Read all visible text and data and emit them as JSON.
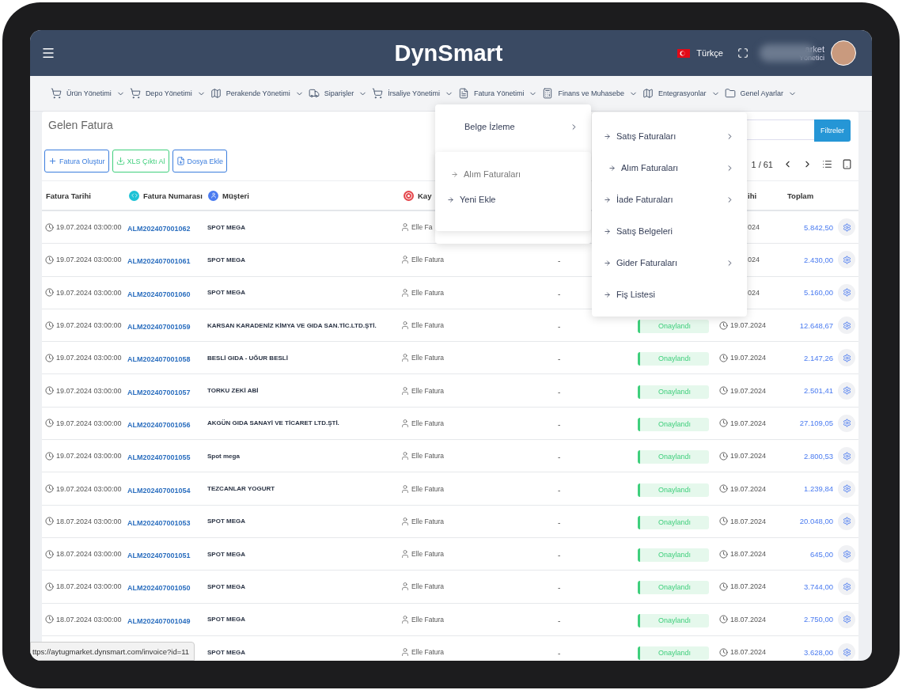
{
  "header": {
    "title": "DynSmart",
    "language": "Türkçe",
    "user_name": "arket",
    "user_role": "Yönetici"
  },
  "nav": [
    {
      "label": "Ürün Yönetimi"
    },
    {
      "label": "Depo Yönetimi"
    },
    {
      "label": "Perakende Yönetimi"
    },
    {
      "label": "Siparişler"
    },
    {
      "label": "İrsaliye Yönetimi"
    },
    {
      "label": "Fatura Yönetimi"
    },
    {
      "label": "Finans ve Muhasebe"
    },
    {
      "label": "Entegrasyonlar"
    },
    {
      "label": "Genel Ayarlar"
    }
  ],
  "page_title": "Gelen Fatura",
  "filter_button": "Filtreler",
  "actions": [
    {
      "label": "Fatura Oluştur",
      "kind": "create"
    },
    {
      "label": "XLS Çıktı Al",
      "kind": "export"
    },
    {
      "label": "Dosya Ekle",
      "kind": "upload"
    }
  ],
  "pagination": {
    "page": "1 / 61"
  },
  "columns": [
    {
      "label": "Fatura Tarihi"
    },
    {
      "label": "Fatura Numarası"
    },
    {
      "label": "Müşteri"
    },
    {
      "label": "Kay"
    },
    {},
    {},
    {
      "label": "ihi"
    },
    {
      "label": "Toplam"
    }
  ],
  "rows": [
    {
      "date": "19.07.2024 03:00:00",
      "number": "ALM202407001062",
      "customer": "SPOT MEGA",
      "source": "Elle Fa",
      "approved_on": "024",
      "total": "5.842,50"
    },
    {
      "date": "19.07.2024 03:00:00",
      "number": "ALM202407001061",
      "customer": "SPOT MEGA",
      "source": "Elle Fatura",
      "col5": "-",
      "approved_on": "024",
      "total": "2.430,00"
    },
    {
      "date": "19.07.2024 03:00:00",
      "number": "ALM202407001060",
      "customer": "SPOT MEGA",
      "source": "Elle Fatura",
      "col5": "-",
      "approved_on": "024",
      "total": "5.160,00"
    },
    {
      "date": "19.07.2024 03:00:00",
      "number": "ALM202407001059",
      "customer": "KARSAN KARADENİZ KİMYA VE GIDA SAN.TİC.LTD.ŞTİ.",
      "source": "Elle Fatura",
      "col5": "-",
      "status": "Onaylandı",
      "approved_on": "19.07.2024",
      "total": "12.648,67"
    },
    {
      "date": "19.07.2024 03:00:00",
      "number": "ALM202407001058",
      "customer": "BESLİ GIDA - UĞUR BESLİ",
      "source": "Elle Fatura",
      "col5": "-",
      "status": "Onaylandı",
      "approved_on": "19.07.2024",
      "total": "2.147,26"
    },
    {
      "date": "19.07.2024 03:00:00",
      "number": "ALM202407001057",
      "customer": "TORKU ZEKİ ABİ",
      "source": "Elle Fatura",
      "col5": "-",
      "status": "Onaylandı",
      "approved_on": "19.07.2024",
      "total": "2.501,41"
    },
    {
      "date": "19.07.2024 03:00:00",
      "number": "ALM202407001056",
      "customer": "AKGÜN GIDA SANAYİ VE TİCARET LTD.ŞTİ.",
      "source": "Elle Fatura",
      "col5": "-",
      "status": "Onaylandı",
      "approved_on": "19.07.2024",
      "total": "27.109,05"
    },
    {
      "date": "19.07.2024 03:00:00",
      "number": "ALM202407001055",
      "customer": "Spot mega",
      "source": "Elle Fatura",
      "col5": "-",
      "status": "Onaylandı",
      "approved_on": "19.07.2024",
      "total": "2.800,53"
    },
    {
      "date": "19.07.2024 03:00:00",
      "number": "ALM202407001054",
      "customer": "TEZCANLAR YOGURT",
      "source": "Elle Fatura",
      "col5": "-",
      "status": "Onaylandı",
      "approved_on": "19.07.2024",
      "total": "1.239,84"
    },
    {
      "date": "18.07.2024 03:00:00",
      "number": "ALM202407001053",
      "customer": "SPOT MEGA",
      "source": "Elle Fatura",
      "col5": "-",
      "status": "Onaylandı",
      "approved_on": "18.07.2024",
      "total": "20.048,00"
    },
    {
      "date": "18.07.2024 03:00:00",
      "number": "ALM202407001051",
      "customer": "SPOT MEGA",
      "source": "Elle Fatura",
      "col5": "-",
      "status": "Onaylandı",
      "approved_on": "18.07.2024",
      "total": "645,00"
    },
    {
      "date": "18.07.2024 03:00:00",
      "number": "ALM202407001050",
      "customer": "SPOT MEGA",
      "source": "Elle Fatura",
      "col5": "-",
      "status": "Onaylandı",
      "approved_on": "18.07.2024",
      "total": "3.744,00"
    },
    {
      "date": "18.07.2024 03:00:00",
      "number": "ALM202407001049",
      "customer": "SPOT MEGA",
      "source": "Elle Fatura",
      "col5": "-",
      "status": "Onaylandı",
      "approved_on": "18.07.2024",
      "total": "2.750,00"
    },
    {
      "customer": "SPOT MEGA",
      "source": "Elle Fatura",
      "col5": "-",
      "status": "Onaylandı",
      "approved_on": "18.07.2024",
      "total": "3.628,00"
    }
  ],
  "menu": {
    "title": "Belge İzleme",
    "items": [
      {
        "label": "Alım Faturaları",
        "dim": true
      },
      {
        "label": "Yeni Ekle",
        "dim": false
      }
    ]
  },
  "submenu": [
    {
      "label": "Satış Faturaları",
      "has_submenu": true,
      "indented": false
    },
    {
      "label": "Alım Faturaları",
      "has_submenu": true,
      "indented": true
    },
    {
      "label": "İade Faturaları",
      "has_submenu": true,
      "indented": false
    },
    {
      "label": "Satış Belgeleri",
      "has_submenu": false,
      "indented": false
    },
    {
      "label": "Gider Faturaları",
      "has_submenu": true,
      "indented": false
    },
    {
      "label": "Fiş Listesi",
      "has_submenu": false,
      "indented": false
    }
  ],
  "status_link": "ttps://aytugmarket.dynsmart.com/invoice?id=11"
}
